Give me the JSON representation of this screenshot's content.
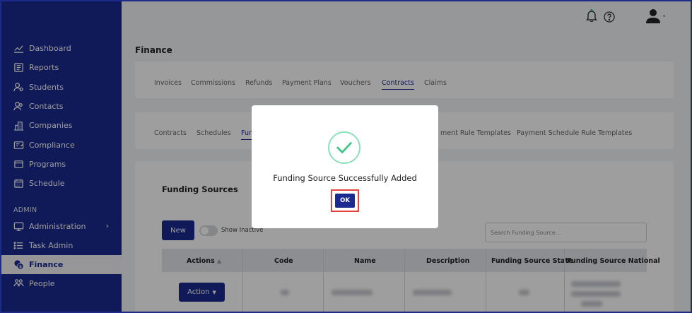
{
  "sidebar": {
    "items": [
      {
        "label": "Dashboard",
        "icon": "chart-line-icon"
      },
      {
        "label": "Reports",
        "icon": "report-icon"
      },
      {
        "label": "Students",
        "icon": "students-icon"
      },
      {
        "label": "Contacts",
        "icon": "contacts-icon"
      },
      {
        "label": "Companies",
        "icon": "companies-icon"
      },
      {
        "label": "Compliance",
        "icon": "compliance-icon"
      },
      {
        "label": "Programs",
        "icon": "programs-icon"
      },
      {
        "label": "Schedule",
        "icon": "calendar-icon"
      }
    ],
    "section_label": "ADMIN",
    "admin_items": [
      {
        "label": "Administration",
        "icon": "monitor-icon"
      },
      {
        "label": "Task Admin",
        "icon": "list-icon"
      },
      {
        "label": "Finance",
        "icon": "finance-icon",
        "active": true
      },
      {
        "label": "People",
        "icon": "people-icon"
      }
    ]
  },
  "page": {
    "title": "Finance",
    "tabs": [
      "Invoices",
      "Commissions",
      "Refunds",
      "Payment Plans",
      "Vouchers",
      "Contracts",
      "Claims"
    ],
    "active_tab": "Contracts",
    "subtabs": [
      "Contracts",
      "Schedules",
      "Fun",
      "ment Rule Templates",
      "Payment Schedule Rule Templates"
    ]
  },
  "funding": {
    "title": "Funding Sources",
    "new_label": "New",
    "toggle_label": "Show Inactive",
    "search_placeholder": "Search Funding Source...",
    "columns": [
      "Actions",
      "Code",
      "Name",
      "Description",
      "Funding Source State",
      "Funding Source National"
    ],
    "action_label": "Action"
  },
  "modal": {
    "message": "Funding Source Successfully Added",
    "ok_label": "OK"
  },
  "colors": {
    "sidebar": "#1b2a8e",
    "primary": "#1b2a8e",
    "success": "#3fc586",
    "highlight": "#e0443c"
  }
}
